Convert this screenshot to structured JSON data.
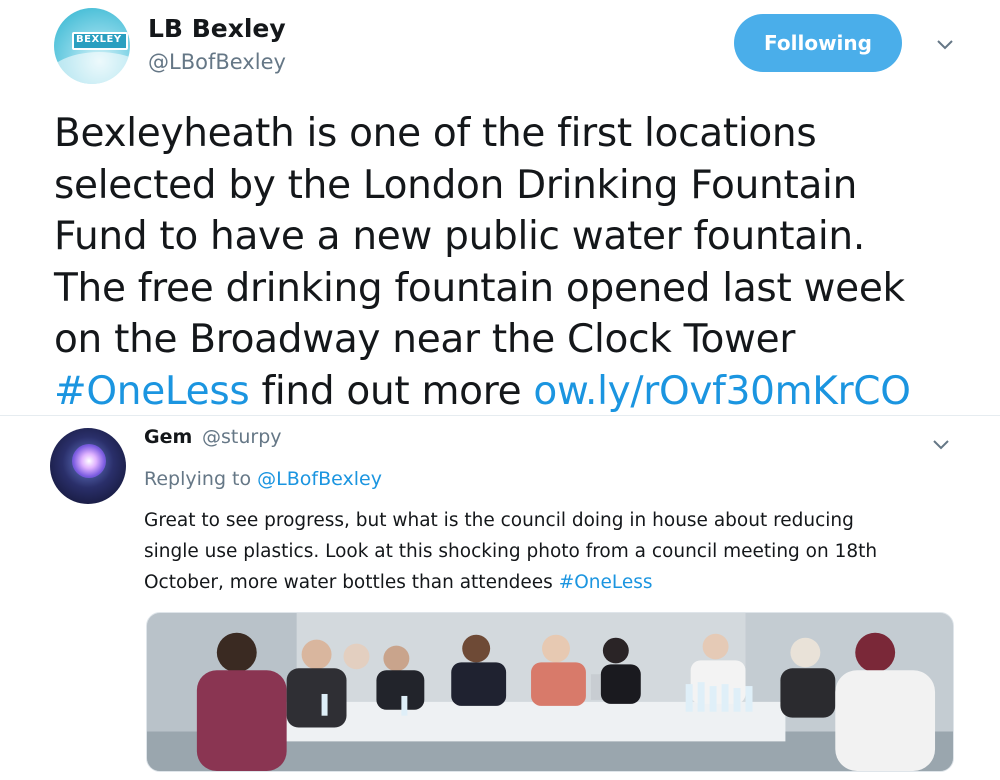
{
  "main_tweet": {
    "display_name": "LB Bexley",
    "handle": "@LBofBexley",
    "avatar_logo_text": "BEXLEY",
    "follow_button_label": "Following",
    "text_lines": [
      "Bexleyheath is one of the first locations",
      "selected by the London Drinking Fountain",
      "Fund to have a new public water fountain.",
      "The free drinking fountain opened last week",
      "on the Broadway near the Clock Tower"
    ],
    "hashtag": "#OneLess",
    "last_line_text": " find out more ",
    "link": "ow.ly/rOvf30mKrCO",
    "icons": {
      "menu": "chevron-down-icon"
    }
  },
  "reply": {
    "display_name": "Gem",
    "handle": "@sturpy",
    "replying_prefix": "Replying to ",
    "replying_to": "@LBofBexley",
    "text_lines": [
      "Great to see progress, but what is the council doing in house about reducing",
      "single use plastics. Look at this shocking photo from a council meeting on 18th"
    ],
    "last_line_text": "October, more water bottles than attendees ",
    "hashtag": "#OneLess",
    "icons": {
      "menu": "chevron-down-icon"
    }
  },
  "colors": {
    "link": "#1b95e0",
    "follow_button": "#4aaeea",
    "secondary_text": "#657786",
    "primary_text": "#14171a"
  }
}
